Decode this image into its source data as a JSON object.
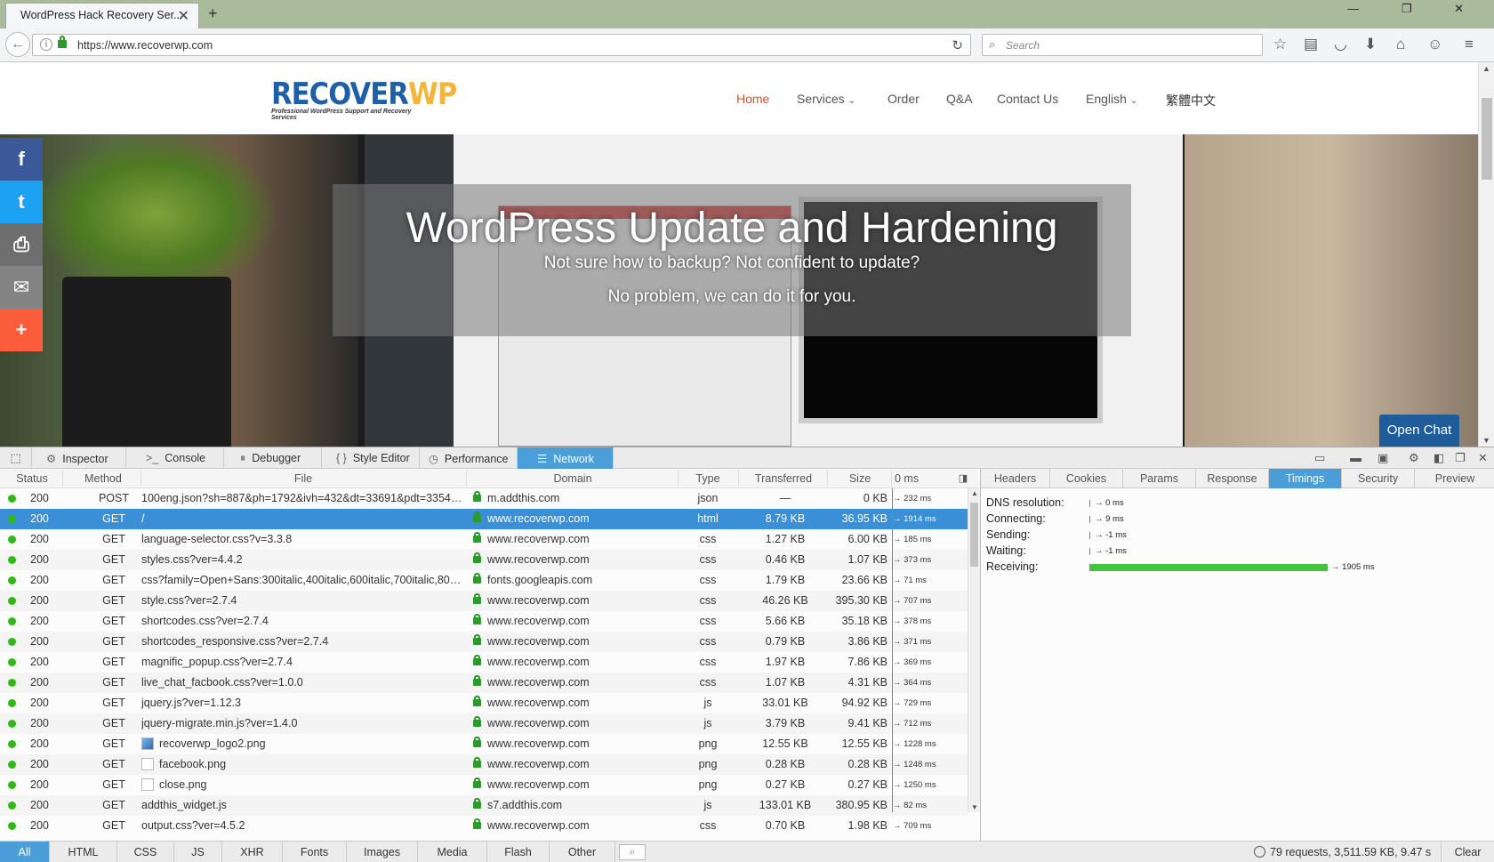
{
  "browser": {
    "tab_title": "WordPress Hack Recovery Ser...",
    "tab_close": "✕",
    "new_tab": "+",
    "window_controls": "— ❐ ✕",
    "url": "https://www.recoverwp.com",
    "search_placeholder": "Search"
  },
  "site": {
    "logo_main": "RECOVER",
    "logo_accent": "WP",
    "logo_tagline": "Professional WordPress Support and Recovery Services",
    "nav": [
      "Home",
      "Services",
      "Order",
      "Q&A",
      "Contact Us",
      "English",
      "繁體中文"
    ],
    "hero_title": "WordPress Update and Hardening",
    "hero_sub1": "Not sure how to backup?  Not confident to update?",
    "hero_sub2": "No problem, we can do it for you.",
    "open_chat": "Open Chat",
    "social": [
      "f",
      "t",
      "⎙",
      "✉",
      "+"
    ]
  },
  "devtools": {
    "tabs": [
      "Inspector",
      "Console",
      "Debugger",
      "Style Editor",
      "Performance",
      "Network"
    ],
    "active_tab": "Network",
    "columns": [
      "Status",
      "Method",
      "File",
      "Domain",
      "Type",
      "Transferred",
      "Size",
      "0 ms"
    ],
    "rows": [
      {
        "status": "200",
        "method": "POST",
        "file": "100eng.json?sh=887&ph=1792&ivh=432&dt=33691&pdt=3354&ic...",
        "domain": "m.addthis.com",
        "type": "json",
        "transferred": "—",
        "size": "0 KB",
        "time": "→ 232 ms"
      },
      {
        "status": "200",
        "method": "GET",
        "file": "/",
        "domain": "www.recoverwp.com",
        "type": "html",
        "transferred": "8.79 KB",
        "size": "36.95 KB",
        "time": "→ 1914 ms"
      },
      {
        "status": "200",
        "method": "GET",
        "file": "language-selector.css?v=3.3.8",
        "domain": "www.recoverwp.com",
        "type": "css",
        "transferred": "1.27 KB",
        "size": "6.00 KB",
        "time": "→ 185 ms"
      },
      {
        "status": "200",
        "method": "GET",
        "file": "styles.css?ver=4.4.2",
        "domain": "www.recoverwp.com",
        "type": "css",
        "transferred": "0.46 KB",
        "size": "1.07 KB",
        "time": "→ 373 ms"
      },
      {
        "status": "200",
        "method": "GET",
        "file": "css?family=Open+Sans:300italic,400italic,600italic,700italic,800italic...",
        "domain": "fonts.googleapis.com",
        "type": "css",
        "transferred": "1.79 KB",
        "size": "23.66 KB",
        "time": "→ 71 ms"
      },
      {
        "status": "200",
        "method": "GET",
        "file": "style.css?ver=2.7.4",
        "domain": "www.recoverwp.com",
        "type": "css",
        "transferred": "46.26 KB",
        "size": "395.30 KB",
        "time": "→ 707 ms"
      },
      {
        "status": "200",
        "method": "GET",
        "file": "shortcodes.css?ver=2.7.4",
        "domain": "www.recoverwp.com",
        "type": "css",
        "transferred": "5.66 KB",
        "size": "35.18 KB",
        "time": "→ 378 ms"
      },
      {
        "status": "200",
        "method": "GET",
        "file": "shortcodes_responsive.css?ver=2.7.4",
        "domain": "www.recoverwp.com",
        "type": "css",
        "transferred": "0.79 KB",
        "size": "3.86 KB",
        "time": "→ 371 ms"
      },
      {
        "status": "200",
        "method": "GET",
        "file": "magnific_popup.css?ver=2.7.4",
        "domain": "www.recoverwp.com",
        "type": "css",
        "transferred": "1.97 KB",
        "size": "7.86 KB",
        "time": "→ 369 ms"
      },
      {
        "status": "200",
        "method": "GET",
        "file": "live_chat_facbook.css?ver=1.0.0",
        "domain": "www.recoverwp.com",
        "type": "css",
        "transferred": "1.07 KB",
        "size": "4.31 KB",
        "time": "→ 364 ms"
      },
      {
        "status": "200",
        "method": "GET",
        "file": "jquery.js?ver=1.12.3",
        "domain": "www.recoverwp.com",
        "type": "js",
        "transferred": "33.01 KB",
        "size": "94.92 KB",
        "time": "→ 729 ms"
      },
      {
        "status": "200",
        "method": "GET",
        "file": "jquery-migrate.min.js?ver=1.4.0",
        "domain": "www.recoverwp.com",
        "type": "js",
        "transferred": "3.79 KB",
        "size": "9.41 KB",
        "time": "→ 712 ms"
      },
      {
        "status": "200",
        "method": "GET",
        "file": "recoverwp_logo2.png",
        "domain": "www.recoverwp.com",
        "type": "png",
        "transferred": "12.55 KB",
        "size": "12.55 KB",
        "time": "→ 1228 ms",
        "thumb": "blue"
      },
      {
        "status": "200",
        "method": "GET",
        "file": "facebook.png",
        "domain": "www.recoverwp.com",
        "type": "png",
        "transferred": "0.28 KB",
        "size": "0.28 KB",
        "time": "→ 1248 ms",
        "thumb": "white"
      },
      {
        "status": "200",
        "method": "GET",
        "file": "close.png",
        "domain": "www.recoverwp.com",
        "type": "png",
        "transferred": "0.27 KB",
        "size": "0.27 KB",
        "time": "→ 1250 ms",
        "thumb": "white"
      },
      {
        "status": "200",
        "method": "GET",
        "file": "addthis_widget.js",
        "domain": "s7.addthis.com",
        "type": "js",
        "transferred": "133.01 KB",
        "size": "380.95 KB",
        "time": "→ 82 ms"
      },
      {
        "status": "200",
        "method": "GET",
        "file": "output.css?ver=4.5.2",
        "domain": "www.recoverwp.com",
        "type": "css",
        "transferred": "0.70 KB",
        "size": "1.98 KB",
        "time": "→ 709 ms"
      }
    ],
    "selected_row": 1,
    "side_tabs": [
      "Headers",
      "Cookies",
      "Params",
      "Response",
      "Timings",
      "Security",
      "Preview"
    ],
    "active_side_tab": "Timings",
    "timings": [
      {
        "label": "DNS resolution:",
        "value": "→ 0 ms"
      },
      {
        "label": "Connecting:",
        "value": "→ 9 ms"
      },
      {
        "label": "Sending:",
        "value": "→ -1 ms"
      },
      {
        "label": "Waiting:",
        "value": "→ -1 ms"
      },
      {
        "label": "Receiving:",
        "value": "→ 1905 ms",
        "bar": true
      }
    ],
    "filters": [
      "All",
      "HTML",
      "CSS",
      "JS",
      "XHR",
      "Fonts",
      "Images",
      "Media",
      "Flash",
      "Other"
    ],
    "active_filter": "All",
    "summary": "79 requests, 3,511.59 KB, 9.47 s",
    "clear": "Clear"
  },
  "colors": {
    "accent": "#4c9ed9",
    "nav_active": "#e44d26",
    "status_ok": "#2cbb0f",
    "receiving_bar": "#43c43c"
  }
}
